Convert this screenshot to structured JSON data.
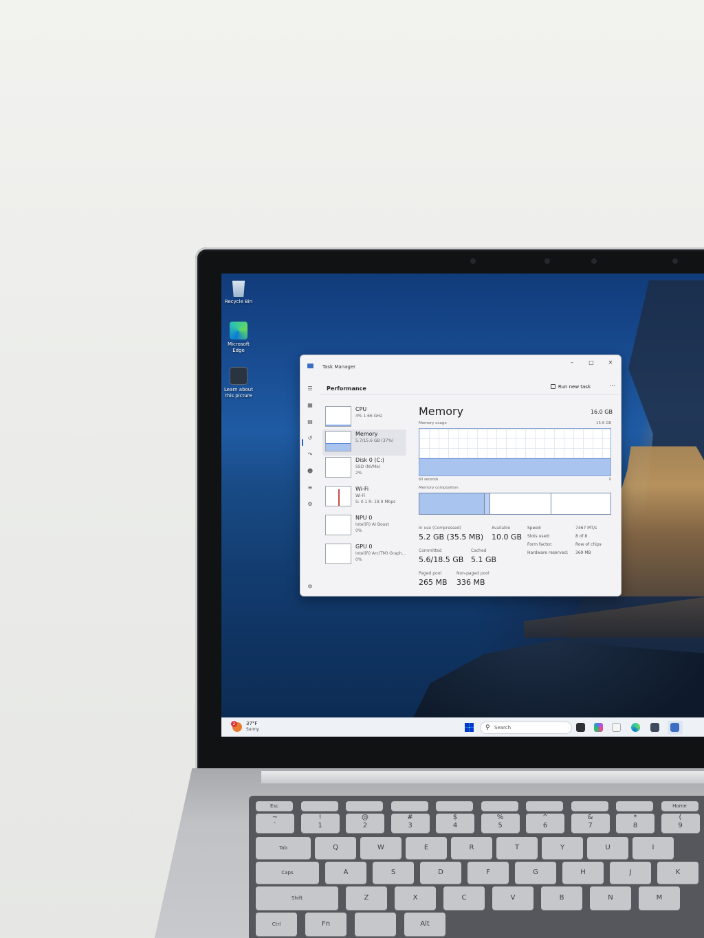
{
  "desktop": {
    "icons": [
      {
        "label_line1": "Recycle Bin",
        "label_line2": "",
        "icon": "recycle-bin-icon"
      },
      {
        "label_line1": "Microsoft",
        "label_line2": "Edge",
        "icon": "edge-icon"
      },
      {
        "label_line1": "Learn about",
        "label_line2": "this picture",
        "icon": "learn-picture-icon"
      }
    ]
  },
  "task_manager": {
    "title": "Task Manager",
    "section_title": "Performance",
    "run_new_task": "Run new task",
    "more": "⋯",
    "window_buttons": {
      "minimize": "–",
      "maximize": "□",
      "close": "✕"
    },
    "perf_items": [
      {
        "name": "CPU",
        "sub": "4%  1.66 GHz",
        "sub2": "",
        "active": false
      },
      {
        "name": "Memory",
        "sub": "5.7/15.6 GB (37%)",
        "sub2": "",
        "active": true
      },
      {
        "name": "Disk 0 (C:)",
        "sub": "SSD (NVMe)",
        "sub2": "2%",
        "active": false
      },
      {
        "name": "Wi-Fi",
        "sub": "Wi-Fi",
        "sub2": "S: 0.1  R: 19.9 Mbps",
        "active": false
      },
      {
        "name": "NPU 0",
        "sub": "Intel(R) AI Boost",
        "sub2": "0%",
        "active": false
      },
      {
        "name": "GPU 0",
        "sub": "Intel(R) Arc(TM) Graph...",
        "sub2": "0%",
        "active": false
      }
    ],
    "memory": {
      "title": "Memory",
      "total": "16.0 GB",
      "usage_label": "Memory usage",
      "usage_max": "15.6 GB",
      "usage_fraction": 0.37,
      "axis_left": "60 seconds",
      "axis_right": "0",
      "composition_label": "Memory composition",
      "composition_in_use_fraction": 0.34,
      "composition_modified_fraction": 0.03,
      "composition_standby_fraction": 0.32,
      "stats": {
        "in_use_label": "In use (Compressed)",
        "in_use_value": "5.2 GB (35.5 MB)",
        "available_label": "Available",
        "available_value": "10.0 GB",
        "committed_label": "Committed",
        "committed_value": "5.6/18.5 GB",
        "cached_label": "Cached",
        "cached_value": "5.1 GB",
        "paged_label": "Paged pool",
        "paged_value": "265 MB",
        "nonpaged_label": "Non-paged pool",
        "nonpaged_value": "336 MB"
      },
      "specs": [
        {
          "key": "Speed:",
          "value": "7467 MT/s"
        },
        {
          "key": "Slots used:",
          "value": "8 of 8"
        },
        {
          "key": "Form factor:",
          "value": "Row of chips"
        },
        {
          "key": "Hardware reserved:",
          "value": "369 MB"
        }
      ]
    }
  },
  "taskbar": {
    "weather_temp": "37°F",
    "weather_condition": "Sunny",
    "weather_badge": "2",
    "search_placeholder": "Search"
  },
  "keyboard": {
    "row_fn": [
      "Esc",
      "",
      "",
      "",
      "",
      "",
      "",
      "",
      "",
      "Home"
    ],
    "row_num": [
      "~\n`",
      "!\n1",
      "@\n2",
      "#\n3",
      "$\n4",
      "%\n5",
      "^\n6",
      "&\n7",
      "*\n8",
      "(\n9"
    ],
    "row_q": [
      "Tab",
      "Q",
      "W",
      "E",
      "R",
      "T",
      "Y",
      "U",
      "I"
    ],
    "row_a": [
      "Caps",
      "A",
      "S",
      "D",
      "F",
      "G",
      "H",
      "J",
      "K"
    ],
    "row_z": [
      "Shift",
      "Z",
      "X",
      "C",
      "V",
      "B",
      "N",
      "M"
    ],
    "row_bottom": [
      "Ctrl",
      "Fn",
      "",
      "Alt"
    ]
  },
  "colors": {
    "accent": "#1f5fd0",
    "memory_fill": "#a8c4ef",
    "memory_line": "#4a7fd8"
  }
}
